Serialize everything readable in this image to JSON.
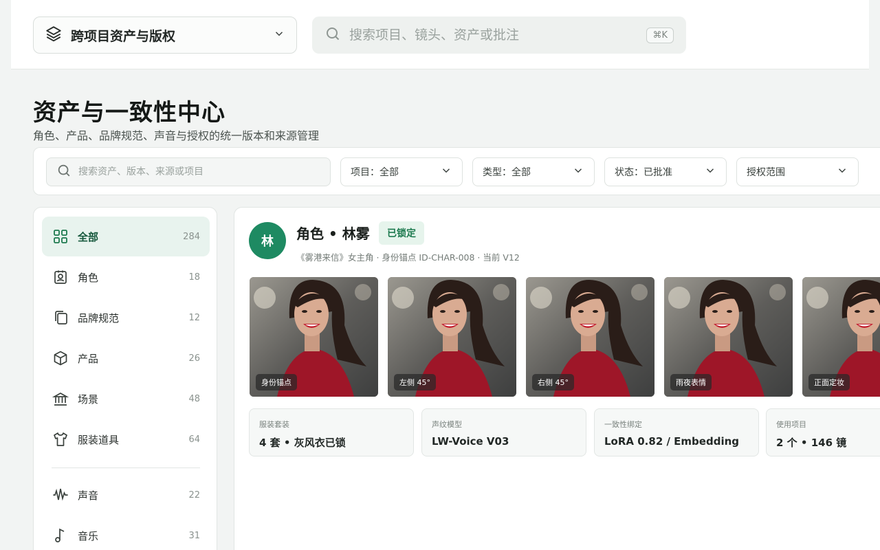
{
  "topbar": {
    "project_select": {
      "label": "跨项目资产与版权"
    },
    "search": {
      "placeholder": "搜索项目、镜头、资产或批注",
      "shortcut": "⌘K"
    }
  },
  "page": {
    "title": "资产与一致性中心",
    "subtitle": "角色、产品、品牌规范、声音与授权的统一版本和来源管理"
  },
  "filters": {
    "search_placeholder": "搜索资产、版本、来源或项目",
    "project": "项目：全部",
    "type": "类型：全部",
    "status": "状态：已批准",
    "license": "授权范围"
  },
  "sidebar": {
    "items": [
      {
        "label": "全部",
        "count": "284",
        "icon": "grid-icon"
      },
      {
        "label": "角色",
        "count": "18",
        "icon": "person-badge-icon"
      },
      {
        "label": "品牌规范",
        "count": "12",
        "icon": "copy-icon"
      },
      {
        "label": "产品",
        "count": "26",
        "icon": "cube-icon"
      },
      {
        "label": "场景",
        "count": "48",
        "icon": "landmark-icon"
      },
      {
        "label": "服装道具",
        "count": "64",
        "icon": "shirt-icon"
      },
      {
        "label": "声音",
        "count": "22",
        "icon": "waveform-icon"
      },
      {
        "label": "音乐",
        "count": "31",
        "icon": "music-note-icon"
      }
    ]
  },
  "asset": {
    "avatar": "林",
    "title": "角色 • 林雾",
    "badge": "已锁定",
    "meta": "《雾港来信》女主角 · 身份锚点 ID-CHAR-008 · 当前 V12",
    "thumbnails": [
      {
        "tag": "身份锚点"
      },
      {
        "tag": "左侧 45°"
      },
      {
        "tag": "右侧 45°"
      },
      {
        "tag": "雨夜表情"
      },
      {
        "tag": "正面定妆"
      }
    ],
    "stats": [
      {
        "label": "服装套装",
        "value": "4 套 • 灰风衣已锁"
      },
      {
        "label": "声纹模型",
        "value": "LW-Voice V03"
      },
      {
        "label": "一致性绑定",
        "value": "LoRA 0.82 / Embedding"
      },
      {
        "label": "使用项目",
        "value": "2 个 • 146 镜"
      }
    ]
  },
  "colors": {
    "accent": "#1e8a62",
    "active_bg": "#e8f3ee",
    "badge_bg": "#e6f4ec"
  }
}
